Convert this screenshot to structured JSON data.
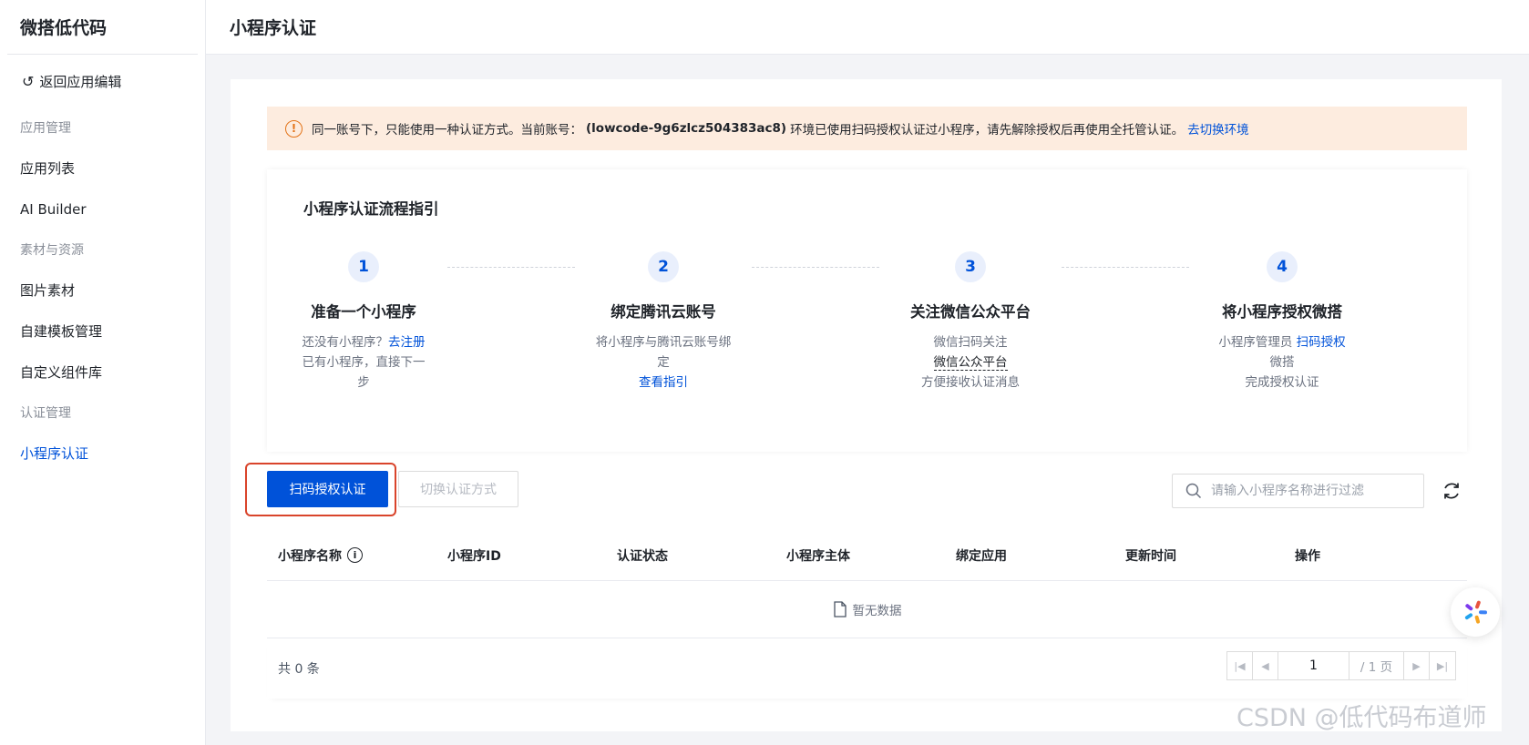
{
  "sidebar": {
    "brand": "微搭低代码",
    "back_label": "返回应用编辑",
    "group_app": "应用管理",
    "item_app_list": "应用列表",
    "item_ai_builder": "AI Builder",
    "group_assets": "素材与资源",
    "item_images": "图片素材",
    "item_templates": "自建模板管理",
    "item_components": "自定义组件库",
    "group_auth": "认证管理",
    "item_mp_auth": "小程序认证"
  },
  "header": {
    "title": "小程序认证"
  },
  "alert": {
    "prefix": "同一账号下，只能使用一种认证方式。当前账号：",
    "account": "(lowcode-9g6zlcz504383ac8)",
    "suffix": "环境已使用扫码授权认证过小程序，请先解除授权后再使用全托管认证。",
    "link": "去切换环境"
  },
  "guide": {
    "title": "小程序认证流程指引",
    "steps": [
      {
        "num": "1",
        "title": "准备一个小程序",
        "line1_text": "还没有小程序？",
        "line1_link": "去注册",
        "line2": "已有小程序，直接下一步"
      },
      {
        "num": "2",
        "title": "绑定腾讯云账号",
        "line1": "将小程序与腾讯云账号绑定",
        "link": "查看指引"
      },
      {
        "num": "3",
        "title": "关注微信公众平台",
        "line1": "微信扫码关注",
        "underline": "微信公众平台",
        "line2": "方便接收认证消息"
      },
      {
        "num": "4",
        "title": "将小程序授权微搭",
        "line1_text": "小程序管理员",
        "line1_link": "扫码授权",
        "line2": "微搭",
        "line3": "完成授权认证"
      }
    ]
  },
  "toolbar": {
    "primary_button": "扫码授权认证",
    "switch_button": "切换认证方式",
    "search_placeholder": "请输入小程序名称进行过滤"
  },
  "table": {
    "columns": [
      "小程序名称",
      "小程序ID",
      "认证状态",
      "小程序主体",
      "绑定应用",
      "更新时间",
      "操作"
    ],
    "empty_text": "暂无数据",
    "total_text": "共 0 条"
  },
  "pager": {
    "current": "1",
    "total": "/ 1 页"
  },
  "watermark": "CSDN @低代码布道师",
  "colors": {
    "brand": "#0052d9",
    "warning": "#e37318",
    "alert_bg": "#fdecdf"
  }
}
